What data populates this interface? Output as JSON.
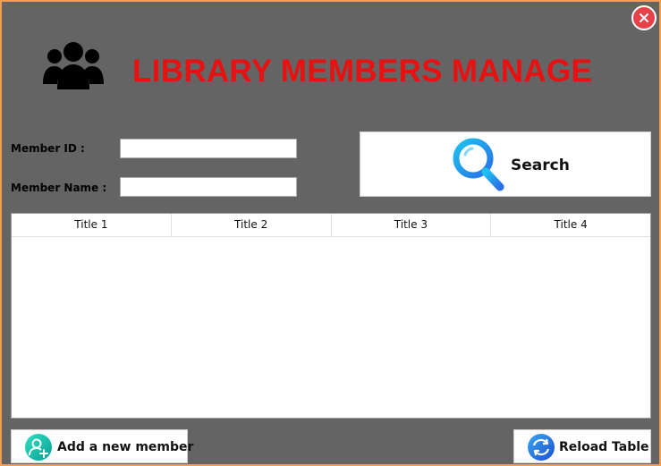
{
  "header": {
    "title": "LIBRARY MEMBERS MANAGE"
  },
  "form": {
    "member_id_label": "Member ID :",
    "member_id_value": "",
    "member_name_label": "Member Name :",
    "member_name_value": ""
  },
  "search": {
    "label": "Search"
  },
  "table": {
    "columns": [
      "Title 1",
      "Title 2",
      "Title 3",
      "Title 4"
    ],
    "rows": []
  },
  "actions": {
    "add_member_label": "Add a new member",
    "reload_label": "Reload Table"
  },
  "icons": {
    "close": "close-icon",
    "logo": "users-group-icon",
    "search": "magnifier-icon",
    "add": "add-user-icon",
    "reload": "refresh-icon"
  },
  "colors": {
    "window_bg": "#646464",
    "title": "#e81010",
    "close_button": "#e8414a",
    "border": "#f0a050"
  }
}
